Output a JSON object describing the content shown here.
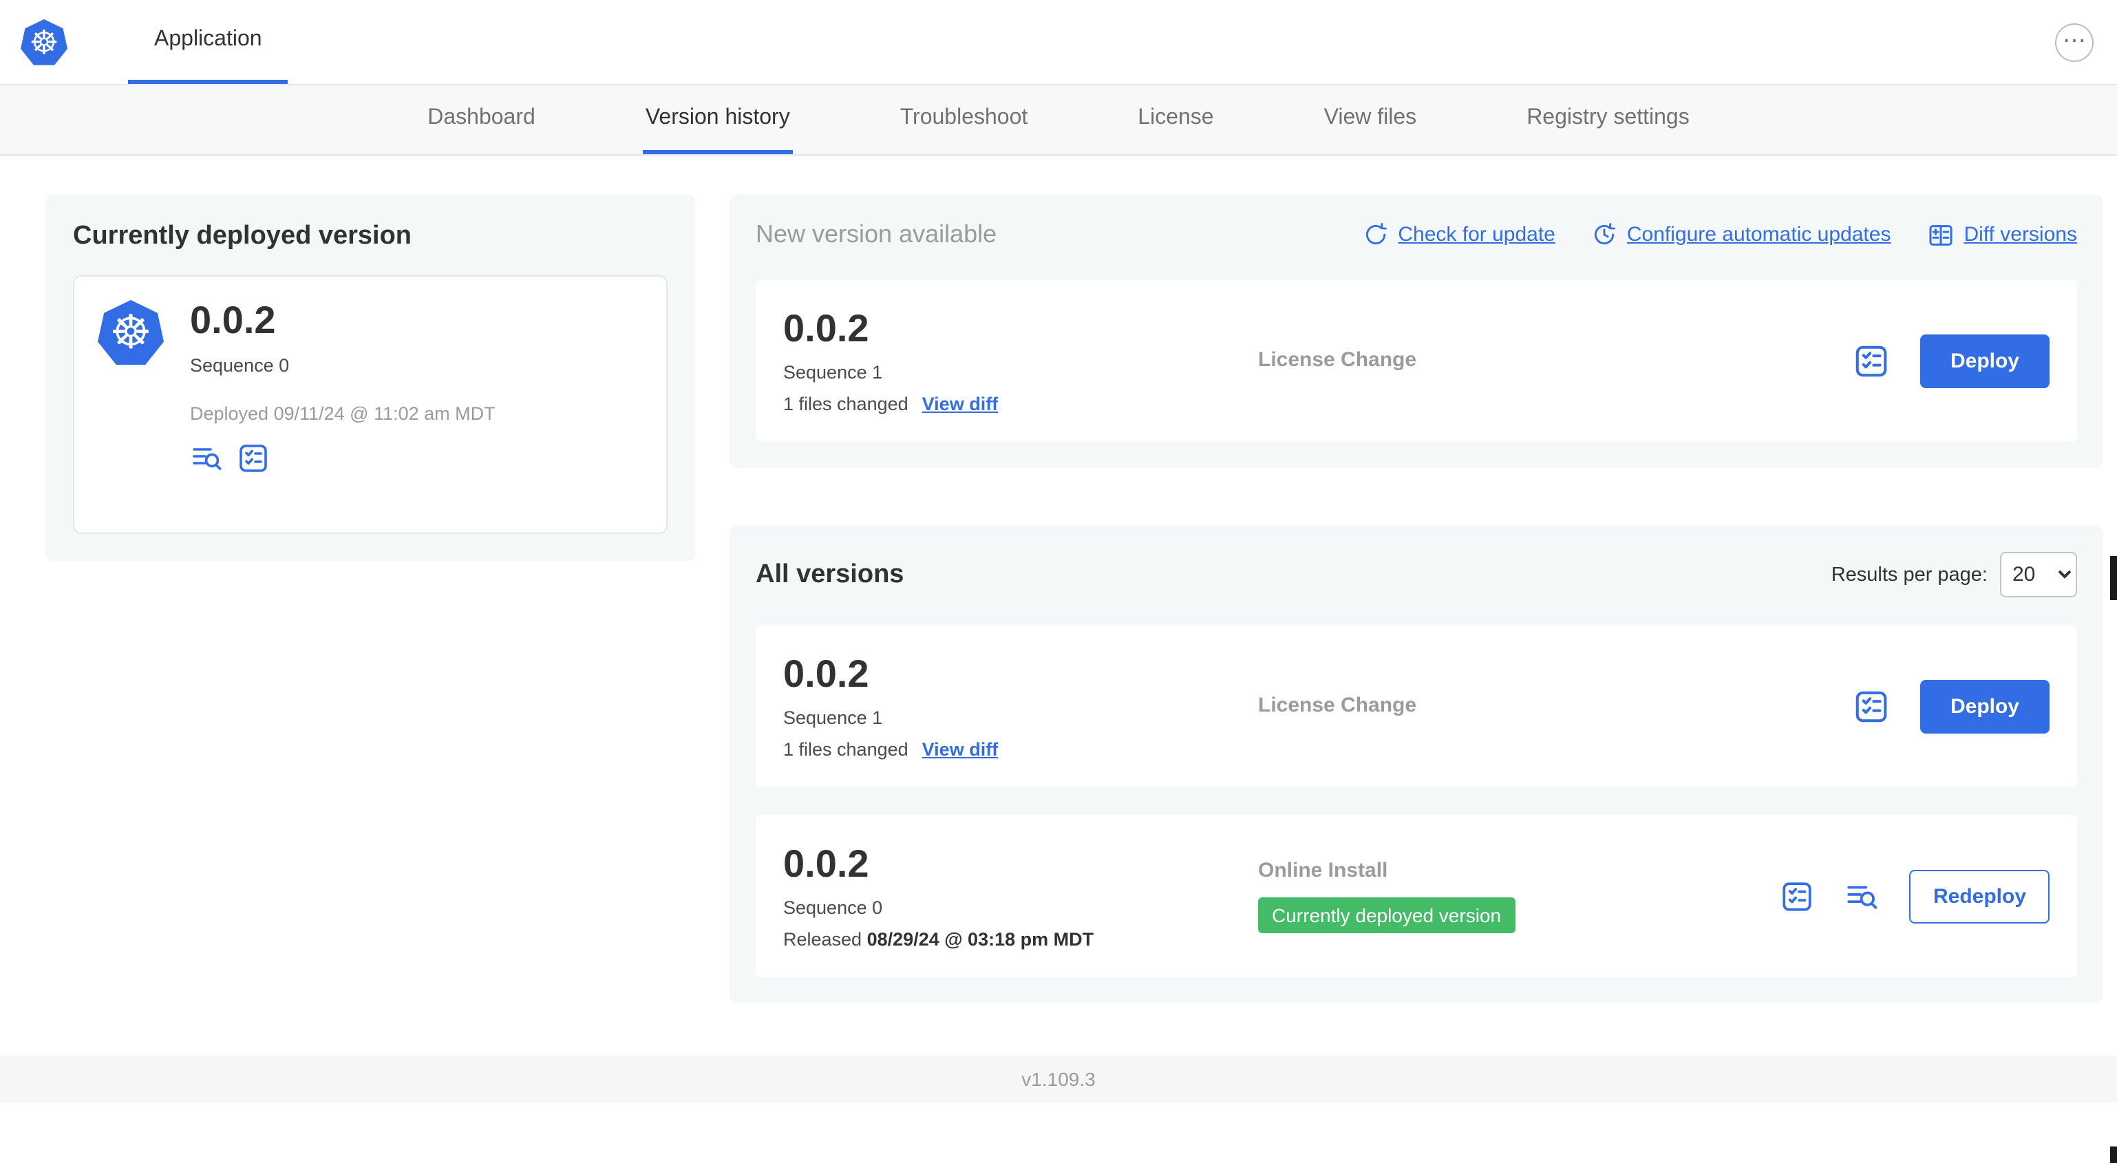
{
  "app": {
    "title": "Application",
    "more_glyph": "⋯",
    "footer_version": "v1.109.3"
  },
  "icons": {
    "wheel_glyph": "☸",
    "app_logo": "kubernetes-logo",
    "refresh": "refresh-icon",
    "auto_update": "clock-refresh-icon",
    "diff": "diff-table-icon",
    "preflight": "checklist-icon",
    "logs": "logs-magnifier-icon"
  },
  "nav": {
    "tabs": [
      {
        "label": "Dashboard",
        "active": false
      },
      {
        "label": "Version history",
        "active": true
      },
      {
        "label": "Troubleshoot",
        "active": false
      },
      {
        "label": "License",
        "active": false
      },
      {
        "label": "View files",
        "active": false
      },
      {
        "label": "Registry settings",
        "active": false
      }
    ]
  },
  "current_version": {
    "heading": "Currently deployed version",
    "version": "0.0.2",
    "sequence": "Sequence 0",
    "deployed": "Deployed 09/11/24 @ 11:02 am MDT"
  },
  "new_version": {
    "heading": "New version available",
    "check_for_update": "Check for update",
    "configure_updates": "Configure automatic updates",
    "diff_versions": "Diff versions",
    "row": {
      "version": "0.0.2",
      "sequence": "Sequence 1",
      "files_changed": "1 files changed",
      "view_diff": "View diff",
      "source": "License Change",
      "action": "Deploy"
    }
  },
  "all_versions": {
    "heading": "All versions",
    "results_per_page_label": "Results per page:",
    "results_per_page_value": "20",
    "rows": [
      {
        "version": "0.0.2",
        "sequence": "Sequence 1",
        "files_changed": "1 files changed",
        "view_diff": "View diff",
        "source": "License Change",
        "action": "Deploy"
      },
      {
        "version": "0.0.2",
        "sequence": "Sequence 0",
        "released_prefix": "Released",
        "released_date": "08/29/24 @ 03:18 pm MDT",
        "source": "Online Install",
        "badge": "Currently deployed version",
        "action": "Redeploy"
      }
    ]
  },
  "colors": {
    "primary_blue": "#326de6",
    "badge_green": "#44bb66",
    "card_bg": "#f5f8f9",
    "muted_text": "#9b9b9b"
  }
}
